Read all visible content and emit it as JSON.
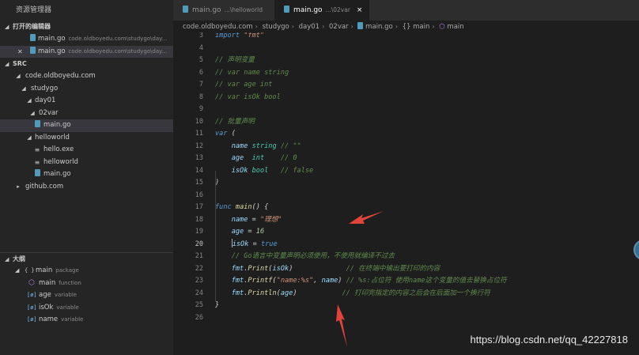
{
  "sidebar": {
    "title": "资源管理器",
    "open_editors": {
      "header": "打开的编辑器",
      "items": [
        {
          "name": "main.go",
          "desc": "code.oldboyedu.com\\studygo\\day..."
        },
        {
          "name": "main.go",
          "desc": "code.oldboyedu.com\\studygo\\day..."
        }
      ]
    },
    "src": {
      "header": "SRC",
      "items": [
        {
          "label": "code.oldboyedu.com",
          "icon": "chevron-down"
        },
        {
          "label": "studygo",
          "icon": "chevron-down"
        },
        {
          "label": "day01",
          "icon": "chevron-down"
        },
        {
          "label": "02var",
          "icon": "chevron-down"
        },
        {
          "label": "main.go",
          "icon": "go-file"
        },
        {
          "label": "helloworld",
          "icon": "chevron-down"
        },
        {
          "label": "hello.exe",
          "icon": "file-lines"
        },
        {
          "label": "helloworld",
          "icon": "file-lines"
        },
        {
          "label": "main.go",
          "icon": "go-file"
        },
        {
          "label": "github.com",
          "icon": "chevron-right"
        }
      ]
    },
    "outline": {
      "header": "大纲",
      "items": [
        {
          "symbol": "{ }",
          "label": "main",
          "kind": "package"
        },
        {
          "symbol": "⬡",
          "label": "main",
          "kind": "function"
        },
        {
          "symbol": "[ø]",
          "label": "age",
          "kind": "variable"
        },
        {
          "symbol": "[ø]",
          "label": "isOk",
          "kind": "variable"
        },
        {
          "symbol": "[ø]",
          "label": "name",
          "kind": "variable"
        }
      ]
    }
  },
  "tabs": [
    {
      "label": "main.go",
      "hint": "...\\helloworld",
      "active": false
    },
    {
      "label": "main.go",
      "hint": "...\\02var",
      "active": true,
      "close": "×"
    }
  ],
  "breadcrumb": [
    "code.oldboyedu.com",
    "studygo",
    "day01",
    "02var",
    "main.go",
    "{} main",
    "main"
  ],
  "editor": {
    "current_line": 20,
    "lines": [
      {
        "n": "3",
        "tokens": [
          [
            "kw",
            "import "
          ],
          [
            "str",
            "\"fmt\""
          ]
        ]
      },
      {
        "n": "4",
        "tokens": []
      },
      {
        "n": "5",
        "tokens": [
          [
            "cm",
            "// 声明变量"
          ]
        ]
      },
      {
        "n": "6",
        "tokens": [
          [
            "cm",
            "// var name string"
          ]
        ]
      },
      {
        "n": "7",
        "tokens": [
          [
            "cm",
            "// var age int"
          ]
        ]
      },
      {
        "n": "8",
        "tokens": [
          [
            "cm",
            "// var isOk bool"
          ]
        ]
      },
      {
        "n": "9",
        "tokens": []
      },
      {
        "n": "10",
        "tokens": [
          [
            "cm",
            "// 批量声明"
          ]
        ]
      },
      {
        "n": "11",
        "tokens": [
          [
            "kw",
            "var"
          ],
          [
            "pl",
            " ("
          ]
        ]
      },
      {
        "n": "12",
        "tokens": [
          [
            "pl",
            "    "
          ],
          [
            "vr",
            "name"
          ],
          [
            "pl",
            " "
          ],
          [
            "ty",
            "string"
          ],
          [
            "pl",
            " "
          ],
          [
            "cm",
            "// \"\""
          ]
        ]
      },
      {
        "n": "13",
        "tokens": [
          [
            "pl",
            "    "
          ],
          [
            "vr",
            "age"
          ],
          [
            "pl",
            "  "
          ],
          [
            "ty",
            "int"
          ],
          [
            "pl",
            "    "
          ],
          [
            "cm",
            "// 0"
          ]
        ]
      },
      {
        "n": "14",
        "tokens": [
          [
            "pl",
            "    "
          ],
          [
            "vr",
            "isOk"
          ],
          [
            "pl",
            " "
          ],
          [
            "ty",
            "bool"
          ],
          [
            "pl",
            "   "
          ],
          [
            "cm",
            "// false"
          ]
        ]
      },
      {
        "n": "15",
        "tokens": [
          [
            "pl",
            ")"
          ]
        ]
      },
      {
        "n": "16",
        "tokens": []
      },
      {
        "n": "17",
        "tokens": [
          [
            "kw",
            "func"
          ],
          [
            "pl",
            " "
          ],
          [
            "fn",
            "main"
          ],
          [
            "pl",
            "() {"
          ]
        ]
      },
      {
        "n": "18",
        "tokens": [
          [
            "pl",
            "    "
          ],
          [
            "vr",
            "name"
          ],
          [
            "pl",
            " = "
          ],
          [
            "str",
            "\"理想\""
          ]
        ]
      },
      {
        "n": "19",
        "tokens": [
          [
            "pl",
            "    "
          ],
          [
            "vr",
            "age"
          ],
          [
            "pl",
            " = "
          ],
          [
            "nm",
            "16"
          ]
        ]
      },
      {
        "n": "20",
        "tokens": [
          [
            "pl",
            "    "
          ],
          [
            "cursor",
            ""
          ],
          [
            "vr",
            "isOk"
          ],
          [
            "pl",
            " = "
          ],
          [
            "kw",
            "true"
          ]
        ]
      },
      {
        "n": "21",
        "tokens": [
          [
            "pl",
            "    "
          ],
          [
            "cm",
            "// Go语言中变量声明必须使用，不使用就编译不过去"
          ]
        ]
      },
      {
        "n": "22",
        "tokens": [
          [
            "pl",
            "    "
          ],
          [
            "vr",
            "fmt"
          ],
          [
            "pl",
            "."
          ],
          [
            "fn",
            "Print"
          ],
          [
            "pl",
            "("
          ],
          [
            "vr",
            "isOk"
          ],
          [
            "pl",
            ")             "
          ],
          [
            "cm",
            "// 在终端中输出要打印的内容"
          ]
        ]
      },
      {
        "n": "23",
        "tokens": [
          [
            "pl",
            "    "
          ],
          [
            "vr",
            "fmt"
          ],
          [
            "pl",
            "."
          ],
          [
            "fn",
            "Printf"
          ],
          [
            "pl",
            "("
          ],
          [
            "str",
            "\"name:%s\""
          ],
          [
            "pl",
            ", "
          ],
          [
            "vr",
            "name"
          ],
          [
            "pl",
            ") "
          ],
          [
            "cm",
            "// %s:占位符 使用name这个变量的值去替换占位符"
          ]
        ]
      },
      {
        "n": "24",
        "tokens": [
          [
            "pl",
            "    "
          ],
          [
            "vr",
            "fmt"
          ],
          [
            "pl",
            "."
          ],
          [
            "fn",
            "Println"
          ],
          [
            "pl",
            "("
          ],
          [
            "vr",
            "age"
          ],
          [
            "pl",
            ")           "
          ],
          [
            "cm",
            "// 打印完指定的内容之后会在后面加一个换行符"
          ]
        ]
      },
      {
        "n": "25",
        "tokens": [
          [
            "pl",
            "}"
          ]
        ]
      },
      {
        "n": "26",
        "tokens": []
      }
    ]
  },
  "watermark": "https://blog.csdn.net/qq_42227818",
  "colors": {
    "arrow": "#e0443a",
    "accent": "#519aba"
  }
}
